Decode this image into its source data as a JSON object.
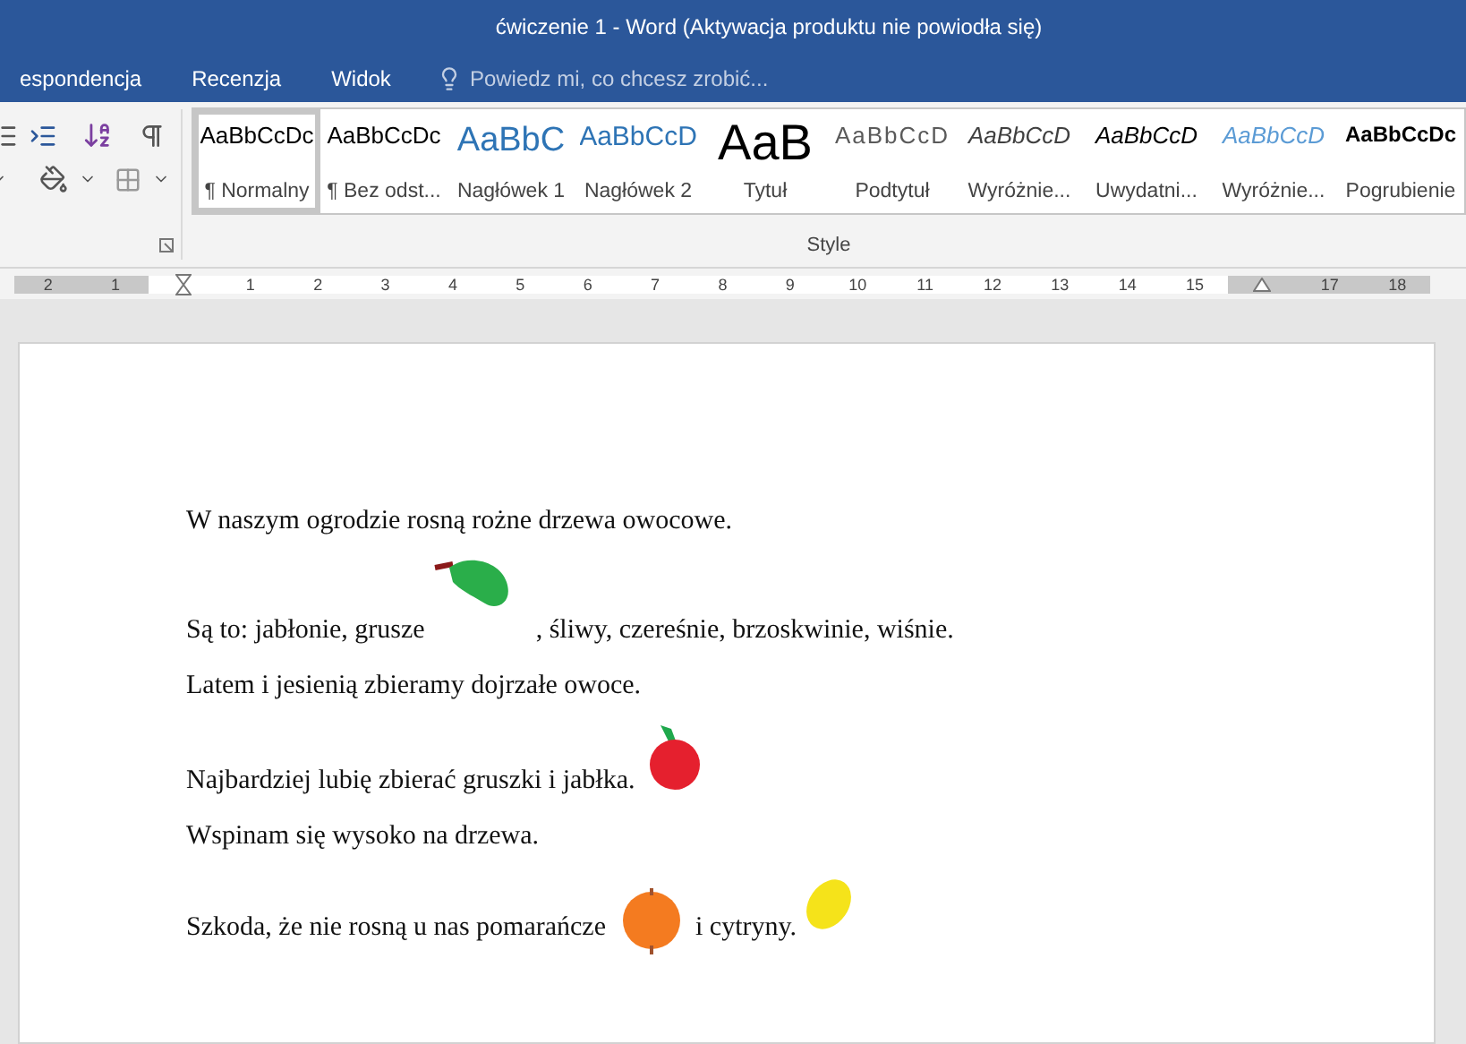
{
  "window": {
    "title": "ćwiczenie 1 - Word (Aktywacja produktu nie powiodła się)"
  },
  "menu": {
    "tabs": [
      {
        "label": "espondencja",
        "selected": false
      },
      {
        "label": "Recenzja",
        "selected": false
      },
      {
        "label": "Widok",
        "selected": false
      }
    ],
    "tell_me": "Powiedz mi, co chcesz zrobić..."
  },
  "styles": {
    "group_label": "Style",
    "items": [
      {
        "preview": "AaBbCcDc",
        "label": "¶ Normalny",
        "kind": "normal",
        "selected": true
      },
      {
        "preview": "AaBbCcDc",
        "label": "¶ Bez odst...",
        "kind": "normal",
        "selected": false
      },
      {
        "preview": "AaBbC",
        "label": "Nagłówek 1",
        "kind": "heading1",
        "selected": false
      },
      {
        "preview": "AaBbCcD",
        "label": "Nagłówek 2",
        "kind": "heading2",
        "selected": false
      },
      {
        "preview": "AaB",
        "label": "Tytuł",
        "kind": "title",
        "selected": false
      },
      {
        "preview": "AaBbCcD",
        "label": "Podtytuł",
        "kind": "subtitle",
        "selected": false
      },
      {
        "preview": "AaBbCcD",
        "label": "Wyróżnie...",
        "kind": "subtle",
        "selected": false
      },
      {
        "preview": "AaBbCcD",
        "label": "Uwydatni...",
        "kind": "emphasis",
        "selected": false
      },
      {
        "preview": "AaBbCcD",
        "label": "Wyróżnie...",
        "kind": "intense",
        "selected": false
      },
      {
        "preview": "AaBbCcDc",
        "label": "Pogrubienie",
        "kind": "strong",
        "selected": false
      }
    ]
  },
  "ruler": {
    "left_labels": [
      "2",
      "1"
    ],
    "labels": [
      "1",
      "2",
      "3",
      "4",
      "5",
      "6",
      "7",
      "8",
      "9",
      "10",
      "11",
      "12",
      "13",
      "14",
      "15"
    ],
    "right_labels": [
      "17",
      "18"
    ]
  },
  "document": {
    "paragraphs": [
      {
        "segments": [
          {
            "kind": "text",
            "text": "W naszym ogrodzie rosną rożne drzewa owocowe."
          }
        ]
      },
      {
        "segments": [
          {
            "kind": "text",
            "text": "Są to: jabłonie, grusze"
          },
          {
            "kind": "pear"
          },
          {
            "kind": "text",
            "text": ", śliwy, czereśnie, brzoskwinie, wiśnie."
          }
        ]
      },
      {
        "segments": [
          {
            "kind": "text",
            "text": "Latem i jesienią zbieramy dojrzałe owoce."
          }
        ]
      },
      {
        "segments": [
          {
            "kind": "text",
            "text": "Najbardziej lubię zbierać gruszki i jabłka."
          },
          {
            "kind": "apple"
          }
        ]
      },
      {
        "segments": [
          {
            "kind": "text",
            "text": "Wspinam się wysoko na drzewa."
          }
        ]
      },
      {
        "segments": [
          {
            "kind": "text",
            "text": "Szkoda, że nie rosną u nas pomarańcze"
          },
          {
            "kind": "orange"
          },
          {
            "kind": "text",
            "text": "i cytryny."
          },
          {
            "kind": "lemon"
          }
        ]
      }
    ]
  }
}
